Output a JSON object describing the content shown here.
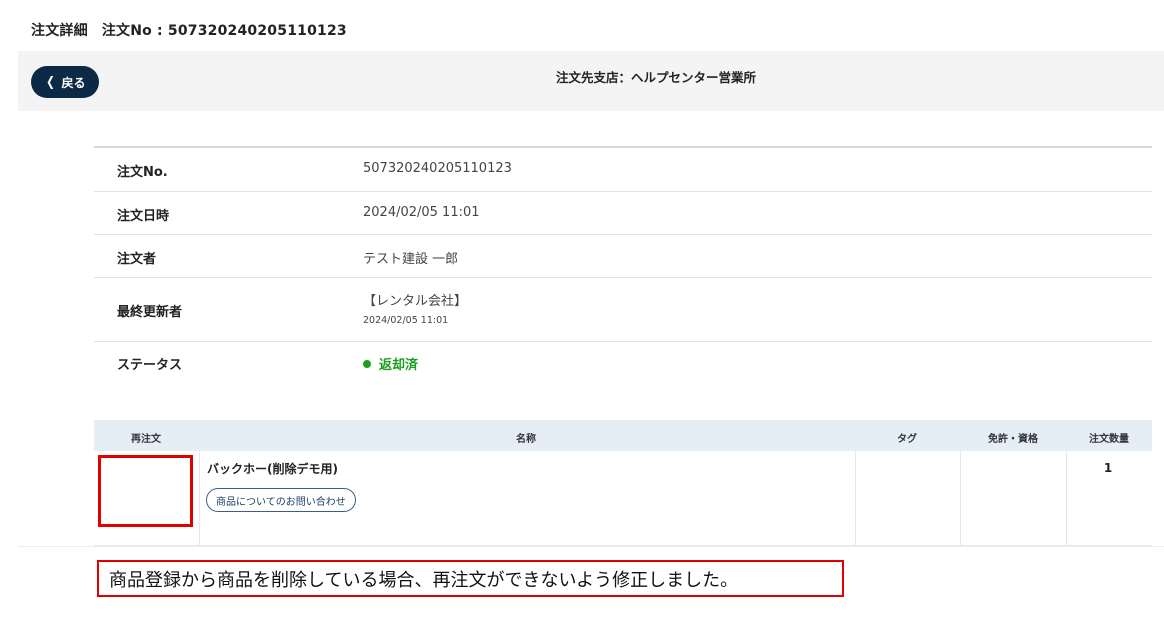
{
  "page": {
    "title_left": "注文詳細",
    "title_right": "注文No : 507320240205110123"
  },
  "header": {
    "back_label": "戻る",
    "store": "注文先支店：ヘルプセンター営業所"
  },
  "order_info": {
    "order_no": {
      "label": "注文No.",
      "value": "507320240205110123"
    },
    "order_date": {
      "label": "注文日時",
      "value": "2024/02/05 11:01"
    },
    "orderer": {
      "label": "注文者",
      "value": "テスト建設 一郎"
    },
    "last_updater": {
      "label": "最終更新者",
      "value": "【レンタル会社】",
      "sub": "2024/02/05 11:01"
    },
    "status": {
      "label": "ステータス",
      "value": "返却済",
      "color": "#1e9e1e"
    }
  },
  "items": {
    "headers": {
      "reorder": "再注文",
      "name": "名称",
      "tag": "タグ",
      "license": "免許・資格",
      "quantity": "注文数量"
    },
    "rows": [
      {
        "name": "バックホー(削除デモ用)",
        "inquiry_label": "商品についてのお問い合わせ",
        "tag": "",
        "license": "",
        "quantity": "1"
      }
    ]
  },
  "annotation": {
    "note": "商品登録から商品を削除している場合、再注文ができないよう修正しました。",
    "highlight_color": "#e00000"
  },
  "colors": {
    "back_button": "#0c2a45",
    "header_bar": "#f4f4f4",
    "table_header": "#e6eef5"
  }
}
